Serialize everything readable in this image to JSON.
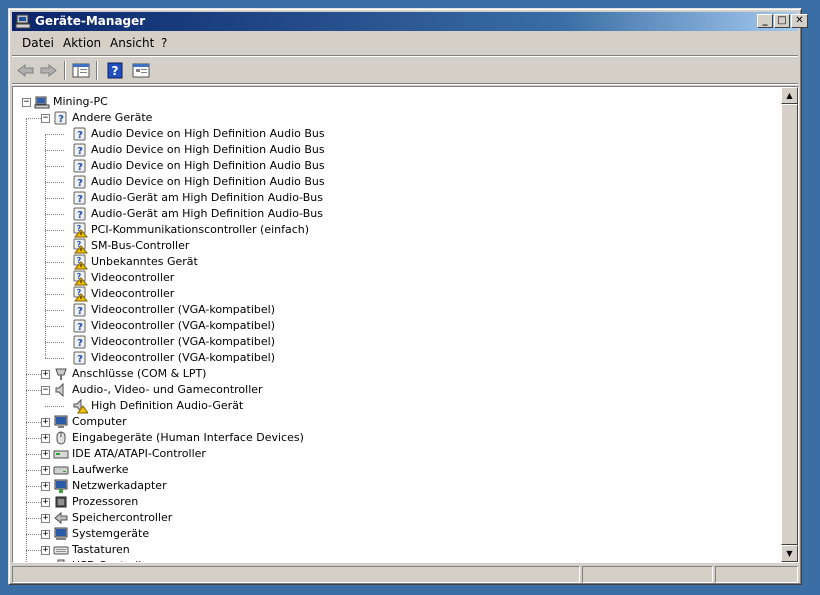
{
  "window": {
    "title": "Geräte-Manager"
  },
  "menu": {
    "items": [
      "Datei",
      "Aktion",
      "Ansicht",
      "?"
    ]
  },
  "toolbar": {
    "items": [
      "back-icon",
      "forward-icon",
      "console-tree-icon",
      "help-icon",
      "properties-icon"
    ]
  },
  "titlebar_buttons": {
    "minimize": "_",
    "maximize": "□",
    "close": "✕"
  },
  "tree": {
    "root": "Mining-PC",
    "rows": [
      {
        "label": "Mining-PC",
        "level": 0,
        "icon": "computer-icon",
        "expander": "minus"
      },
      {
        "label": "Andere Geräte",
        "level": 1,
        "icon": "unknown-device-icon",
        "expander": "minus"
      },
      {
        "label": "Audio Device on High Definition Audio Bus",
        "level": 2,
        "icon": "unknown-device-icon"
      },
      {
        "label": "Audio Device on High Definition Audio Bus",
        "level": 2,
        "icon": "unknown-device-icon"
      },
      {
        "label": "Audio Device on High Definition Audio Bus",
        "level": 2,
        "icon": "unknown-device-icon"
      },
      {
        "label": "Audio Device on High Definition Audio Bus",
        "level": 2,
        "icon": "unknown-device-icon"
      },
      {
        "label": "Audio-Gerät am High Definition Audio-Bus",
        "level": 2,
        "icon": "unknown-device-icon"
      },
      {
        "label": "Audio-Gerät am High Definition Audio-Bus",
        "level": 2,
        "icon": "unknown-device-icon"
      },
      {
        "label": "PCI-Kommunikationscontroller (einfach)",
        "level": 2,
        "icon": "warning-device-icon"
      },
      {
        "label": "SM-Bus-Controller",
        "level": 2,
        "icon": "warning-device-icon"
      },
      {
        "label": "Unbekanntes Gerät",
        "level": 2,
        "icon": "warning-device-icon"
      },
      {
        "label": "Videocontroller",
        "level": 2,
        "icon": "warning-device-icon"
      },
      {
        "label": "Videocontroller",
        "level": 2,
        "icon": "warning-device-icon"
      },
      {
        "label": "Videocontroller (VGA-kompatibel)",
        "level": 2,
        "icon": "unknown-device-icon"
      },
      {
        "label": "Videocontroller (VGA-kompatibel)",
        "level": 2,
        "icon": "unknown-device-icon"
      },
      {
        "label": "Videocontroller (VGA-kompatibel)",
        "level": 2,
        "icon": "unknown-device-icon"
      },
      {
        "label": "Videocontroller (VGA-kompatibel)",
        "level": 2,
        "icon": "unknown-device-icon"
      },
      {
        "label": "Anschlüsse (COM & LPT)",
        "level": 1,
        "icon": "port-icon",
        "expander": "plus"
      },
      {
        "label": "Audio-, Video- und Gamecontroller",
        "level": 1,
        "icon": "speaker-icon",
        "expander": "minus"
      },
      {
        "label": "High Definition Audio-Gerät",
        "level": 2,
        "icon": "speaker-warning-icon"
      },
      {
        "label": "Computer",
        "level": 1,
        "icon": "monitor-icon",
        "expander": "plus"
      },
      {
        "label": "Eingabegeräte (Human Interface Devices)",
        "level": 1,
        "icon": "hid-icon",
        "expander": "plus"
      },
      {
        "label": "IDE ATA/ATAPI-Controller",
        "level": 1,
        "icon": "ide-icon",
        "expander": "plus"
      },
      {
        "label": "Laufwerke",
        "level": 1,
        "icon": "drive-icon",
        "expander": "plus"
      },
      {
        "label": "Netzwerkadapter",
        "level": 1,
        "icon": "network-icon",
        "expander": "plus"
      },
      {
        "label": "Prozessoren",
        "level": 1,
        "icon": "processor-icon",
        "expander": "plus"
      },
      {
        "label": "Speichercontroller",
        "level": 1,
        "icon": "storage-icon",
        "expander": "plus"
      },
      {
        "label": "Systemgeräte",
        "level": 1,
        "icon": "system-icon",
        "expander": "plus"
      },
      {
        "label": "Tastaturen",
        "level": 1,
        "icon": "keyboard-icon",
        "expander": "plus"
      },
      {
        "label": "USB-Controller",
        "level": 1,
        "icon": "usb-icon",
        "expander": "plus"
      }
    ]
  },
  "colors": {
    "titlebar": "#0a246a",
    "desktop": "#3a6ea5",
    "face": "#d4d0c8",
    "warning": "#f2c200"
  }
}
